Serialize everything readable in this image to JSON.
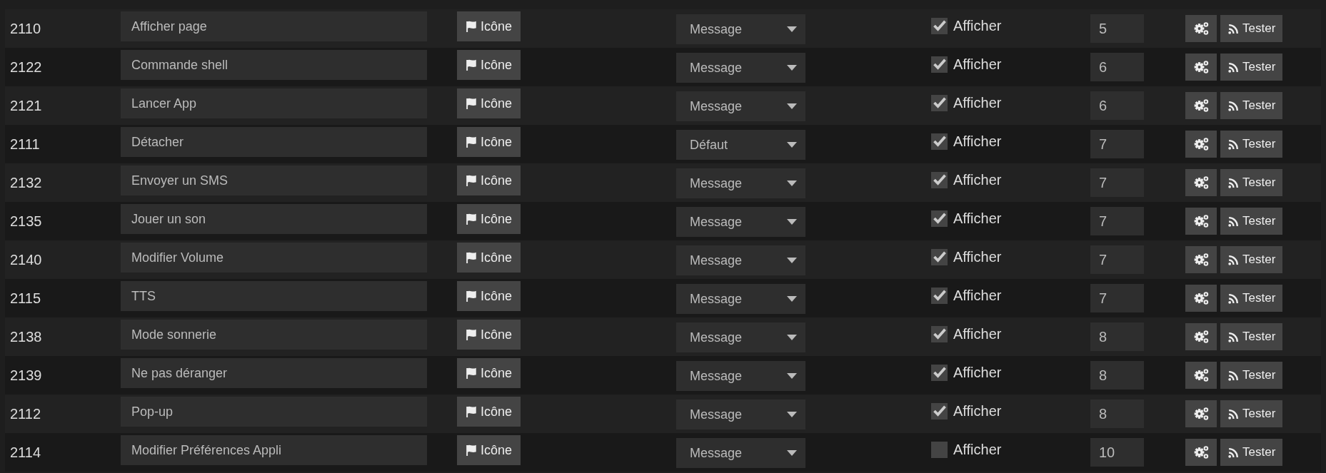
{
  "rows": [
    {
      "id": "2110",
      "name": "Afficher page",
      "icon_button": "Icône",
      "mode": "Message",
      "show": {
        "label": "Afficher",
        "checked": true
      },
      "order": "5",
      "test_button": "Tester"
    },
    {
      "id": "2122",
      "name": "Commande shell",
      "icon_button": "Icône",
      "mode": "Message",
      "show": {
        "label": "Afficher",
        "checked": true
      },
      "order": "6",
      "test_button": "Tester"
    },
    {
      "id": "2121",
      "name": "Lancer App",
      "icon_button": "Icône",
      "mode": "Message",
      "show": {
        "label": "Afficher",
        "checked": true
      },
      "order": "6",
      "test_button": "Tester"
    },
    {
      "id": "2111",
      "name": "Détacher",
      "icon_button": "Icône",
      "mode": "Défaut",
      "show": {
        "label": "Afficher",
        "checked": true
      },
      "order": "7",
      "test_button": "Tester"
    },
    {
      "id": "2132",
      "name": "Envoyer un SMS",
      "icon_button": "Icône",
      "mode": "Message",
      "show": {
        "label": "Afficher",
        "checked": true
      },
      "order": "7",
      "test_button": "Tester"
    },
    {
      "id": "2135",
      "name": "Jouer un son",
      "icon_button": "Icône",
      "mode": "Message",
      "show": {
        "label": "Afficher",
        "checked": true
      },
      "order": "7",
      "test_button": "Tester"
    },
    {
      "id": "2140",
      "name": "Modifier Volume",
      "icon_button": "Icône",
      "mode": "Message",
      "show": {
        "label": "Afficher",
        "checked": true
      },
      "order": "7",
      "test_button": "Tester"
    },
    {
      "id": "2115",
      "name": "TTS",
      "icon_button": "Icône",
      "mode": "Message",
      "show": {
        "label": "Afficher",
        "checked": true
      },
      "order": "7",
      "test_button": "Tester"
    },
    {
      "id": "2138",
      "name": "Mode sonnerie",
      "icon_button": "Icône",
      "mode": "Message",
      "show": {
        "label": "Afficher",
        "checked": true
      },
      "order": "8",
      "test_button": "Tester"
    },
    {
      "id": "2139",
      "name": "Ne pas déranger",
      "icon_button": "Icône",
      "mode": "Message",
      "show": {
        "label": "Afficher",
        "checked": true
      },
      "order": "8",
      "test_button": "Tester"
    },
    {
      "id": "2112",
      "name": "Pop-up",
      "icon_button": "Icône",
      "mode": "Message",
      "show": {
        "label": "Afficher",
        "checked": true
      },
      "order": "8",
      "test_button": "Tester"
    },
    {
      "id": "2114",
      "name": "Modifier Préférences Appli",
      "icon_button": "Icône",
      "mode": "Message",
      "show": {
        "label": "Afficher",
        "checked": false
      },
      "order": "10",
      "test_button": "Tester"
    }
  ]
}
